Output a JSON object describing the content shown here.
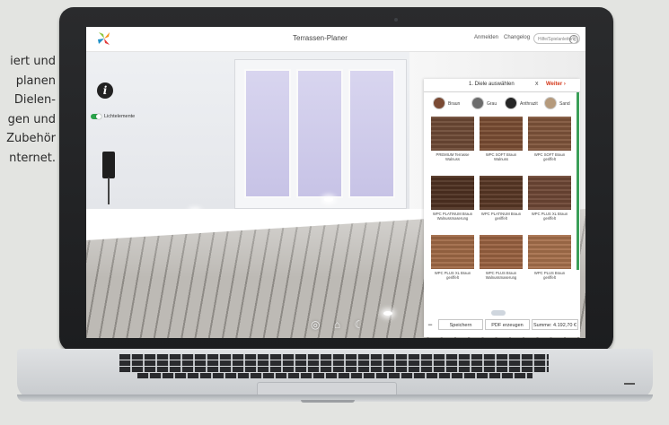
{
  "side_text": [
    "iert und",
    "planen",
    "Dielen-",
    "gen und",
    "Zubehör",
    "nternet."
  ],
  "app": {
    "title": "Terrassen-Planer",
    "links": [
      "Anmelden",
      "Changelog"
    ],
    "help_label": "Hilfe/Spielanleitung",
    "help_icon": "?"
  },
  "viewer": {
    "toggle_label": "Lichtelemente",
    "info_icon": "i",
    "bottom_icons": [
      "360-view-icon",
      "house-icon",
      "night-mode-icon"
    ]
  },
  "panel": {
    "step": "1. Diele auswählen",
    "close": "x",
    "next": "Weiter",
    "colors": [
      {
        "label": "Braun",
        "color": "#7a4a34"
      },
      {
        "label": "Grau",
        "color": "#6c6c6c"
      },
      {
        "label": "Anthrazit",
        "color": "#262626"
      },
      {
        "label": "Sand",
        "color": "#b59a7c"
      }
    ],
    "products": [
      {
        "name": "PREMIUM Terrasse Walnuss",
        "color": "#6e4a36"
      },
      {
        "name": "WPC SOFT Braun Walnuss",
        "color": "#7a4d33"
      },
      {
        "name": "WPC SOFT Braun geriffelt",
        "color": "#80553b"
      },
      {
        "name": "WPC PLATINUM Braun Walnussmaserung",
        "color": "#4f3121"
      },
      {
        "name": "WPC PLATINUM Braun geriffelt",
        "color": "#583725"
      },
      {
        "name": "WPC PLUS XL Braun geriffelt",
        "color": "#6e4735"
      },
      {
        "name": "WPC PLUS XL Braun geriffelt",
        "color": "#a06a46"
      },
      {
        "name": "WPC PLUS Braun Walnussmaserung",
        "color": "#9a6241"
      },
      {
        "name": "WPC PLUS Braun geriffelt",
        "color": "#a7704c"
      }
    ],
    "footer": {
      "minus": "−",
      "save": "Speichern",
      "pdf": "PDF erzeugen",
      "sum": "Summe: 4.192,70 €"
    }
  }
}
